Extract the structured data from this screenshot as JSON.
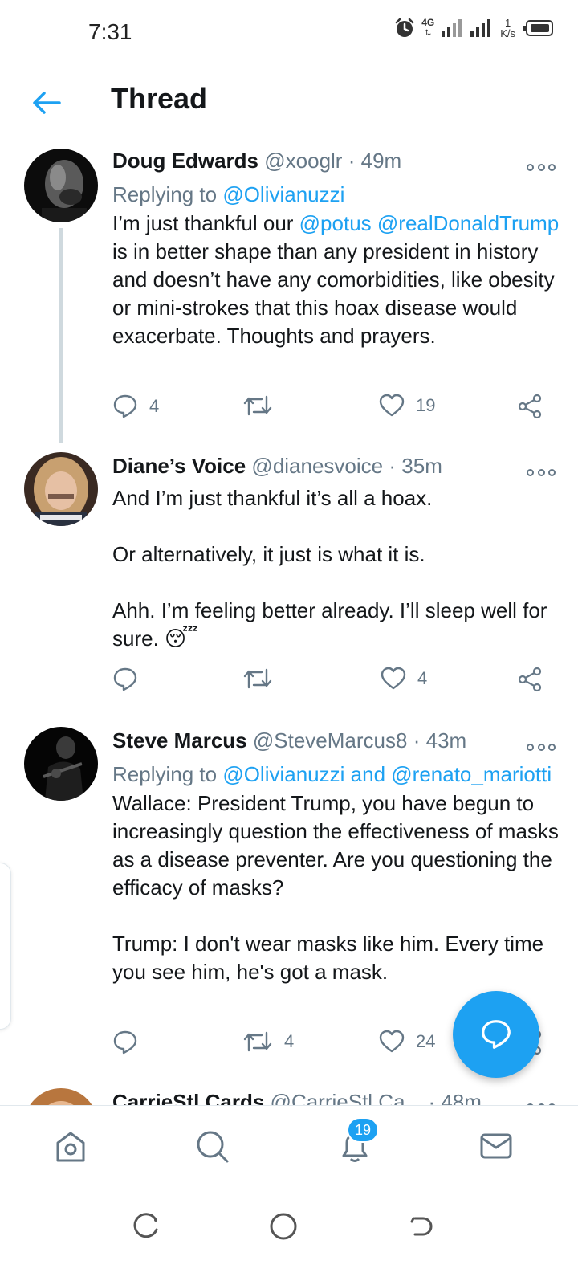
{
  "status_bar": {
    "time": "7:31",
    "network_type": "4G",
    "net_speed_value": "1",
    "net_speed_unit": "K/s"
  },
  "header": {
    "title": "Thread"
  },
  "tweets": [
    {
      "name": "Doug Edwards",
      "handle": "@xooglr",
      "separator": "·",
      "time": "49m",
      "replying_label": "Replying to",
      "replying_to": [
        "@Olivianuzzi"
      ],
      "body_segments": [
        {
          "text": "I’m just thankful our ",
          "link": false
        },
        {
          "text": "@potus",
          "link": true
        },
        {
          "text": " ",
          "link": false
        },
        {
          "text": "@realDonaldTrump",
          "link": true
        },
        {
          "text": " is in better shape than any president in history and doesn’t have any comorbidities, like obesity or mini-strokes that this hoax disease would exacerbate.  Thoughts and prayers.",
          "link": false
        }
      ],
      "reply_count": "4",
      "retweet_count": "",
      "like_count": "19"
    },
    {
      "name": "Diane’s Voice",
      "handle": "@dianesvoice",
      "separator": "·",
      "time": "35m",
      "paragraphs": [
        "And I’m just thankful it’s all a hoax.",
        "Or alternatively, it just is what it is.",
        "Ahh.  I’m feeling better already.  I’ll sleep well for sure. 😴"
      ],
      "reply_count": "",
      "retweet_count": "",
      "like_count": "4"
    },
    {
      "name": "Steve Marcus",
      "handle": "@SteveMarcus8",
      "separator": "·",
      "time": "43m",
      "replying_label": "Replying to",
      "replying_to": [
        "@Olivianuzzi",
        "@renato_mariotti"
      ],
      "replying_and": "and",
      "paragraphs": [
        "Wallace: President Trump, you have begun to increasingly question the effectiveness of masks as a disease preventer. Are you questioning the efficacy of masks?",
        "Trump: I don't wear masks like him. Every time you see him, he's got a mask."
      ],
      "reply_count": "",
      "retweet_count": "4",
      "like_count": "24"
    },
    {
      "name": "CarrieStl Cards",
      "handle": "@CarrieStl Ca...",
      "separator": "·",
      "time": "48m"
    }
  ],
  "bottom_nav": {
    "items": [
      "home-icon",
      "search-icon",
      "notifications-icon",
      "messages-icon"
    ],
    "notification_badge": "19"
  },
  "colors": {
    "accent": "#1da1f2",
    "text": "#14171a",
    "secondary": "#657786",
    "divider": "#e1e8ed"
  }
}
